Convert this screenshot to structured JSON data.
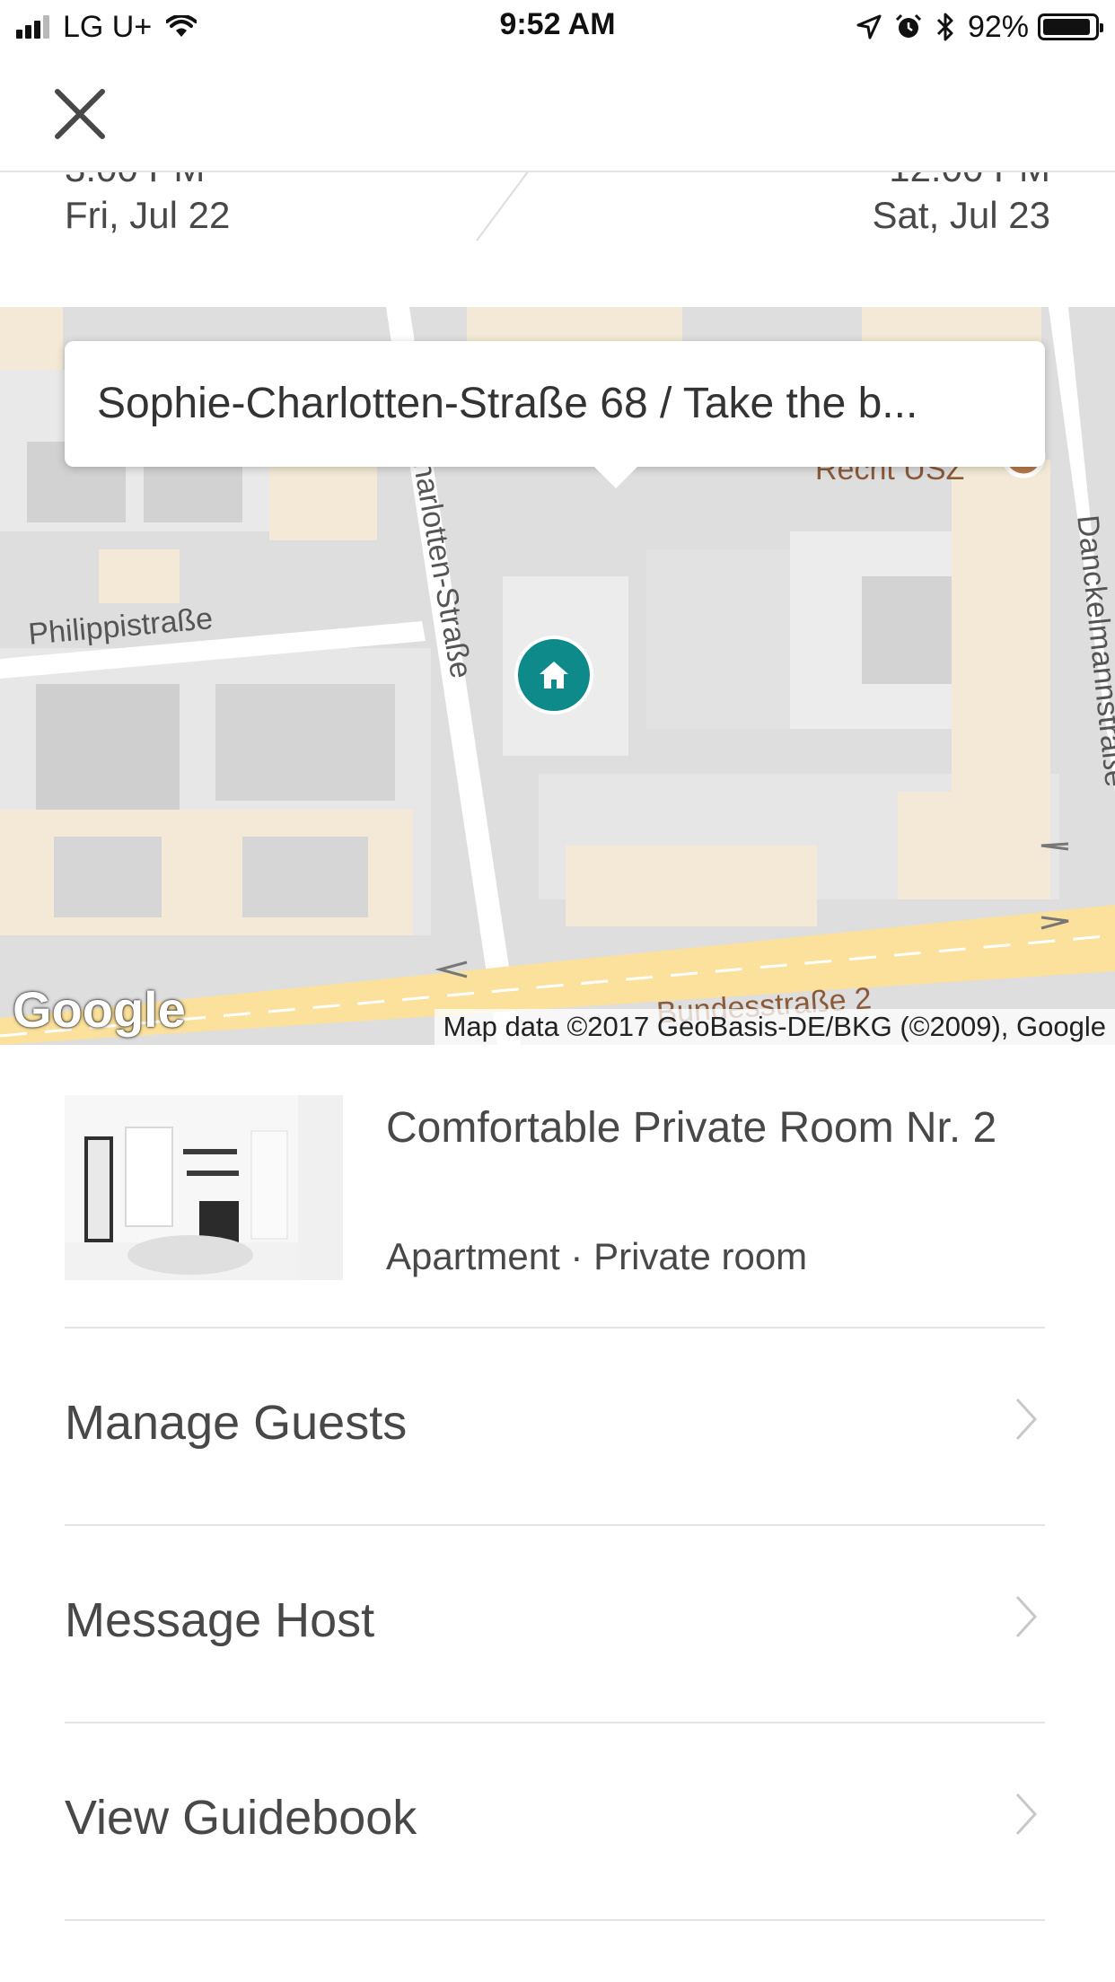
{
  "status_bar": {
    "carrier": "LG U+",
    "time": "9:52 AM",
    "battery": "92%",
    "battery_level": 0.92,
    "signal_bars": 3
  },
  "reservation": {
    "checkin_time_partial": "3:00 PM",
    "checkin_date": "Fri, Jul 22",
    "checkout_time_partial": "12:00 PM",
    "checkout_date": "Sat, Jul 23"
  },
  "map": {
    "callout": "Sophie-Charlotten-Straße 68 / Take the b...",
    "streets": {
      "philippi": "Philippistraße",
      "sophie": "harlotten-Straße",
      "danckelmann": "Danckelmannstraße",
      "bundes": "Bundesstraße 2",
      "recht": "Recht USZ"
    },
    "logo": "Google",
    "attribution": "Map data ©2017 GeoBasis-DE/BKG (©2009), Google",
    "pin_icon": "home-icon"
  },
  "listing": {
    "title": "Comfortable Private Room Nr. 2",
    "subtitle": "Apartment · Private room"
  },
  "actions": [
    {
      "label": "Manage Guests"
    },
    {
      "label": "Message Host"
    },
    {
      "label": "View Guidebook"
    }
  ],
  "colors": {
    "accent": "#0f8a8a",
    "text": "#484848",
    "divider": "#e4e4e4"
  }
}
